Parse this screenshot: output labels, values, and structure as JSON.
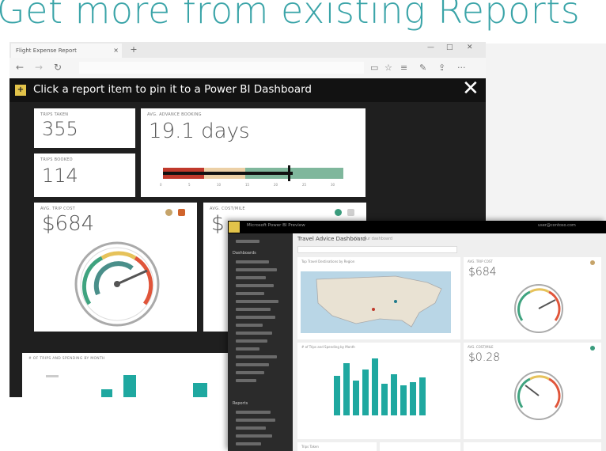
{
  "headline": "Get more from existing Reports",
  "browser": {
    "tab_label": "Flight Expense Report",
    "tab_close": "×",
    "new_tab": "+",
    "window_controls": [
      "—",
      "□",
      "✕"
    ]
  },
  "pin_banner": {
    "badge": "+",
    "text": "Click a report item to pin it to a Power BI Dashboard",
    "close": "✕"
  },
  "tiles": {
    "trips_taken": {
      "label": "TRIPS TAKEN",
      "value": "355"
    },
    "trips_booked": {
      "label": "TRIPS BOOKED",
      "value": "114"
    },
    "advance_booking": {
      "label": "AVG. ADVANCE BOOKING",
      "value": "19.1 days",
      "bullet_ticks": [
        "0",
        "5",
        "10",
        "15",
        "20",
        "25",
        "30"
      ]
    },
    "avg_trip_cost": {
      "label": "AVG. TRIP COST",
      "value": "$684"
    },
    "avg_cost_mile": {
      "label": "AVG. COST/MILE",
      "value": "$"
    },
    "bottom_chart": {
      "label": "# OF TRIPS AND SPENDING BY MONTH"
    }
  },
  "pbi": {
    "app_name": "Microsoft Power BI Preview",
    "user": "user@contoso.com",
    "dashboard_title": "Travel Advice Dashboard",
    "dashboard_sub": "Fly your dashboard",
    "nav_section_dashboards": "Dashboards",
    "nav_section_reports": "Reports",
    "map_tile_label": "Top Travel Destinations by Region",
    "chart_tile_label": "# of Trips and Spending by Month",
    "tile_trip_cost": {
      "label": "AVG. TRIP COST",
      "value": "$684"
    },
    "tile_cost_mile": {
      "label": "AVG. COST/MILE",
      "value": "$0.28"
    },
    "bottom_tile_label": "Trips Taken"
  },
  "colors": {
    "headline": "#3aa4a8",
    "accent_yellow": "#e2c34a",
    "teal_bars": "#1fa8a0"
  },
  "icons": [
    "back-arrow-icon",
    "forward-arrow-icon",
    "refresh-icon",
    "reading-view-icon",
    "favorite-star-icon",
    "hub-icon",
    "notes-icon",
    "share-icon",
    "more-icon",
    "pin-icon",
    "close-icon"
  ]
}
